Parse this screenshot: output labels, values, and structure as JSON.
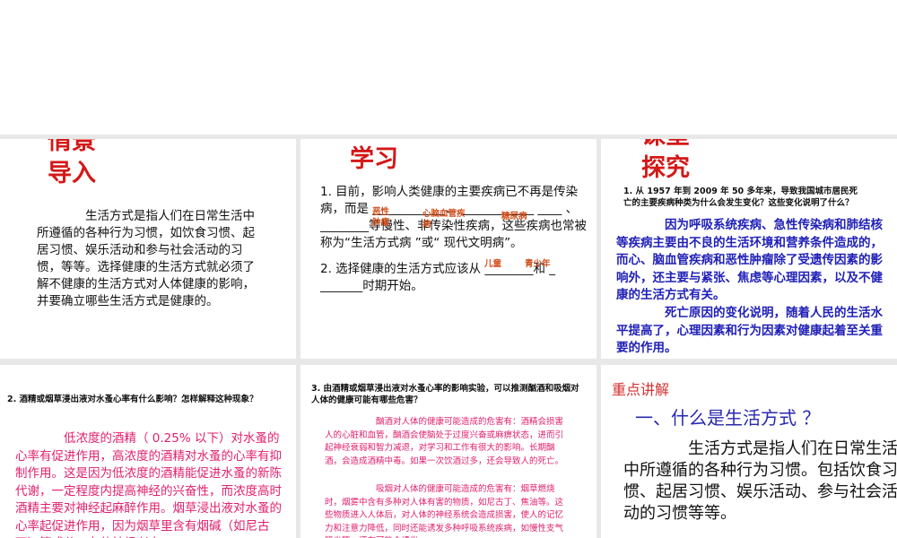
{
  "slide1": {
    "title_lines": [
      "情景",
      "导入"
    ],
    "body": "　　　　生活方式是指人们在日常生活中所遵循的各种行为习惯，如饮食习惯、起居习惯、娱乐活动和参与社会活动的习惯，等等。选择健康的生活方式就必须了解不健康的生活方式对人体健康的影响，并要确立哪些生活方式是健康的。"
  },
  "slide2": {
    "title": "学习",
    "line1": "1. 目前，影响人类健康的主要疾病已不再是传染病，而是 ____________、 ____________ ____ 、 ________等慢性、非传染性疾病，这些疾病也常被称为“生活方式病 ”或“ 现代文明病”。",
    "line2": "2. 选择健康的生活方式应该从 ________和 _ _______时期开始。",
    "answers": [
      "恶性肿瘤",
      "心脑血管疾病",
      "糖尿病",
      "儿童",
      "青少年"
    ]
  },
  "slide3": {
    "title_lines": [
      "课堂",
      "探究"
    ],
    "question": "1. 从 1957 年到 2009 年 50 多年来，导致我国城市居民死亡的主要疾病种类为什么会发生变化？这些变化说明了什么？",
    "answer1": "　　　　因为呼吸系统疾病、急性传染病和肺结核等疾病主要由不良的生活环境和营养条件造成的，而心、脑血管疾病和恶性肿瘤除了受遗传因素的影响外，还主要与紧张、焦虑等心理因素，以及不健康的生活方式有关。",
    "answer2": "　　　　死亡原因的变化说明，随着人民的生活水平提高了，心理因素和行为因素对健康起着至关重要的作用。"
  },
  "slide4": {
    "question": "2. 酒精或烟草浸出液对水蚤心率有什么影响？怎样解释这种现象？",
    "answer": "　　　　低浓度的酒精（ 0.25% 以下）对水蚤的心率有促进作用，高浓度的酒精对水蚤的心率有抑制作用。这是因为低浓度的酒精能促进水蚤的新陈代谢，一定程度内提高神经的兴奋性，而浓度高时酒精主要对神经起麻醉作用。烟草浸出液对水蚤的心率起促进作用，因为烟草里含有烟碱（如尼古丁）等成分，有使神经兴奋"
  },
  "slide5": {
    "question": "3. 由酒精或烟草浸出液对水蚤心率的影响实验，可以推测酗酒和吸烟对人体的健康可能有哪些危害？",
    "para1": "　　　　　　酗酒对人体的健康可能造成的危害有：酒精会损害人的心脏和血管，酗酒会使脑处于过度兴奋或麻痹状态，进而引起神经衰弱和智力减退，对学习和工作有很大的影响。长期酗酒，会造成酒精中毒。如果一次饮酒过多，还会导致人的死亡。",
    "para2": "　　　　　　吸烟对人体的健康可能造成的危害有：烟草燃烧时，烟雾中含有多种对人体有害的物质，如尼古丁、焦油等。这些物质进入人体后，对人体的神经系统会造成损害，使人的记忆力和注意力降低，同时还能诱发多种呼吸系统疾病，如慢性支气管炎等，还有可能会诱发"
  },
  "slide6": {
    "tag": "重点讲解",
    "heading": "一、什么是生活方式 ？",
    "body": "　　　　生活方式是指人们在日常生活中所遵循的各种行为习惯。包括饮食习惯、起居习惯、娱乐活动、参与社会活动的习惯等等。"
  }
}
